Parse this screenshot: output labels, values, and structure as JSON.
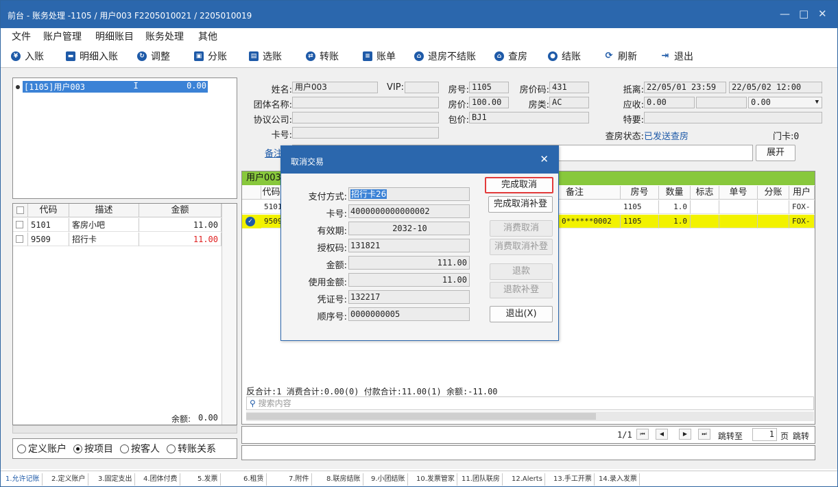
{
  "window": {
    "title": "前台 - 账务处理 -1105 / 用户003 F2205010021 / 2205010019",
    "controls": {
      "min": "—",
      "max": "□",
      "close": "✕"
    }
  },
  "menu": [
    "文件",
    "账户管理",
    "明细账目",
    "账务处理",
    "其他"
  ],
  "toolbar": [
    {
      "label": "入账",
      "icon": "yen-icon"
    },
    {
      "label": "明细入账",
      "icon": "card-icon"
    },
    {
      "label": "调整",
      "icon": "adjust-icon"
    },
    {
      "label": "分账",
      "icon": "split-icon"
    },
    {
      "label": "选账",
      "icon": "select-icon"
    },
    {
      "label": "转账",
      "icon": "transfer-icon"
    },
    {
      "label": "账单",
      "icon": "bill-icon"
    },
    {
      "label": "退房不结账",
      "icon": "house-icon"
    },
    {
      "label": "查房",
      "icon": "room-check-icon"
    },
    {
      "label": "结账",
      "icon": "coins-icon"
    },
    {
      "label": "刷新",
      "icon": "refresh-icon"
    },
    {
      "label": "退出",
      "icon": "exit-icon"
    }
  ],
  "tree": {
    "node_label": "[1105]用户003",
    "node_flag": "I",
    "node_amount": "0.00"
  },
  "items_grid": {
    "headers": [
      "代码",
      "描述",
      "金额"
    ],
    "rows": [
      {
        "code": "5101",
        "desc": "客房小吧",
        "amount": "11.00",
        "red": false
      },
      {
        "code": "9509",
        "desc": "招行卡",
        "amount": "11.00",
        "red": true
      }
    ],
    "balance_label": "余额:",
    "balance_value": "0.00"
  },
  "radios": [
    {
      "label": "定义账户",
      "checked": false
    },
    {
      "label": "按项目",
      "checked": true
    },
    {
      "label": "按客人",
      "checked": false
    },
    {
      "label": "转账关系",
      "checked": false
    }
  ],
  "guest": {
    "name_label": "姓名:",
    "name": "用户003",
    "vip_label": "VIP:",
    "vip": "",
    "room_label": "房号:",
    "room": "1105",
    "rate_code_label": "房价码:",
    "rate_code": "431",
    "arrive_label": "抵离:",
    "arrive": "22/05/01 23:59",
    "depart": "22/05/02 12:00",
    "group_label": "团体名称:",
    "group": "",
    "price_label": "房价:",
    "price": "100.00",
    "room_type_label": "房类:",
    "room_type": "AC",
    "receivable_label": "应收:",
    "receivable": "0.00",
    "receivable2": "",
    "receivable3": "0.00",
    "company_label": "协议公司:",
    "company": "",
    "package_label": "包价:",
    "package": "BJ1",
    "special_label": "特要:",
    "special": "",
    "card_label": "卡号:",
    "card": "",
    "check_status_label": "查房状态:",
    "check_status": "已发送查房",
    "door_card_label": "门卡:",
    "door_card": "0",
    "remark_label": "备注",
    "expand_label": "展开"
  },
  "transactions": {
    "header_tab": "用户003",
    "headers": [
      "代码",
      "备注",
      "房号",
      "数量",
      "标志",
      "单号",
      "分账",
      "用户"
    ],
    "rows": [
      {
        "code": "5101",
        "remark": "",
        "room": "1105",
        "qty": "1.0",
        "user": "FOX-",
        "highlight": false
      },
      {
        "code": "9509",
        "remark": "0******0002",
        "room": "1105",
        "qty": "1.0",
        "user": "FOX-",
        "highlight": true
      }
    ],
    "footer": "合计:1  消费合计:0.00(0)  付款合计:11.00(1)  余额:-11.00",
    "footer_prefix": "反",
    "search_placeholder": "搜索内容"
  },
  "pager": {
    "page_info": "1/1",
    "jump_label": "跳转至",
    "page_input": "1",
    "page_unit": "页",
    "jump_button": "跳转"
  },
  "tabs": [
    "1.允许记账",
    "2.定义账户",
    "3.固定支出",
    "4.团体付费",
    "5.发票",
    "6.租赁",
    "7.附件",
    "8.联房结账",
    "9.小团结账",
    "10.发票管家",
    "11.团队联房",
    "12.Alerts",
    "13.手工开票",
    "14.录入发票"
  ],
  "dialog": {
    "title": "取消交易",
    "fields": [
      {
        "label": "支付方式:",
        "value": "招行卡26"
      },
      {
        "label": "卡号:",
        "value": "4000000000000002"
      },
      {
        "label": "有效期:",
        "value": "2032-10"
      },
      {
        "label": "授权码:",
        "value": "131821"
      },
      {
        "label": "金额:",
        "value": "111.00"
      },
      {
        "label": "使用金额:",
        "value": "11.00"
      },
      {
        "label": "凭证号:",
        "value": "132217"
      },
      {
        "label": "顺序号:",
        "value": "0000000005"
      }
    ],
    "buttons": {
      "complete_cancel": "完成取消",
      "complete_cancel_supp": "完成取消补登",
      "consume_cancel": "消费取消",
      "consume_cancel_supp": "消费取消补登",
      "refund": "退款",
      "refund_supp": "退款补登",
      "exit": "退出(X)"
    }
  }
}
